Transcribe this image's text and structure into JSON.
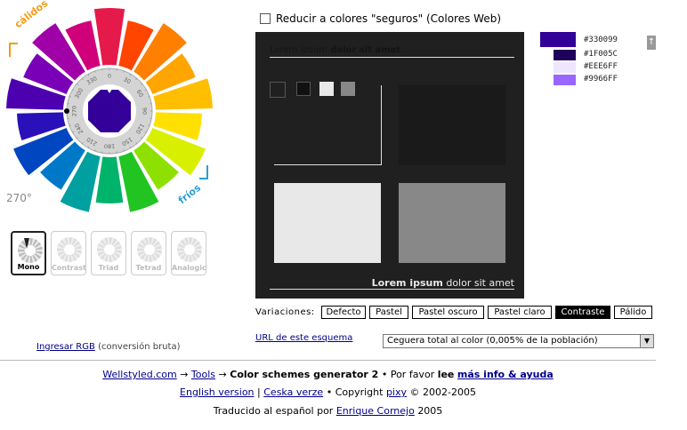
{
  "wheel": {
    "warm_label": "cálidos",
    "cold_label": "fríos",
    "degree_readout": "270°",
    "dial_ticks": [
      "0",
      "30",
      "60",
      "90",
      "120",
      "150",
      "180",
      "210",
      "240",
      "270",
      "300",
      "330"
    ],
    "selected_color": "#330099"
  },
  "scheme_types": [
    {
      "label": "Mono",
      "active": true
    },
    {
      "label": "Contrast",
      "active": false
    },
    {
      "label": "Triad",
      "active": false
    },
    {
      "label": "Tetrad",
      "active": false
    },
    {
      "label": "Analogic",
      "active": false
    }
  ],
  "web_safe_checkbox": {
    "label": "Reducir a colores \"seguros\" (Colores Web)",
    "checked": false
  },
  "preview": {
    "title_plain": "Lorem ipsum",
    "title_bold": "dolor sit amet",
    "footer_bold": "Lorem ipsum",
    "footer_plain": "dolor sit amet",
    "colors": {
      "panel": "#202020",
      "box_dark": "#1a1a1a",
      "box_light": "#e8e8e8",
      "box_mid": "#888888"
    }
  },
  "variations": {
    "label": "Variaciones:",
    "options": [
      "Defecto",
      "Pastel",
      "Pastel oscuro",
      "Pastel claro",
      "Contraste",
      "Pálido"
    ],
    "active": "Contraste"
  },
  "palette": [
    {
      "hex": "#330099",
      "color": "#330099"
    },
    {
      "hex": "#1F005C",
      "color": "#1F005C"
    },
    {
      "hex": "#EEE6FF",
      "color": "#EEE6FF"
    },
    {
      "hex": "#9966FF",
      "color": "#9966FF"
    }
  ],
  "scheme_url_link": "URL de este esquema",
  "rgb_input": {
    "link": "Ingresar RGB",
    "note": "(conversión bruta)"
  },
  "vision_select": {
    "value": "Ceguera total al color (0,005% de la población)"
  },
  "footer": {
    "line1": {
      "site": "Wellstyled.com",
      "arrow1": "→",
      "tools": "Tools",
      "arrow2": "→",
      "current": "Color schemes generator 2",
      "bullet": "•",
      "please": "Por favor",
      "read": "lee",
      "more_info": "más info & ayuda"
    },
    "line2": {
      "english": "English version",
      "sep": "|",
      "czech": "Ceska verze",
      "bullet": "•",
      "copyright": "Copyright",
      "author": "pixy",
      "years": "© 2002-2005"
    },
    "line3": {
      "translated": "Traducido al español por",
      "translator": "Enrique Cornejo",
      "year": "2005"
    }
  }
}
